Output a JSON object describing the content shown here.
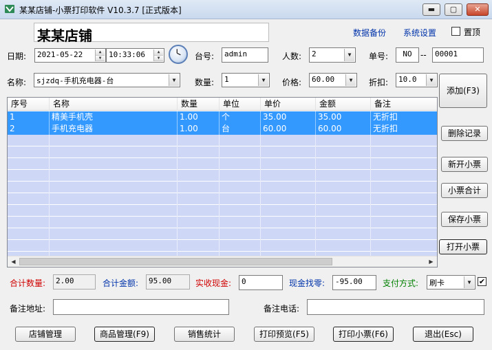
{
  "window": {
    "title": "某某店铺-小票打印软件 V10.3.7 [正式版本]",
    "minimize": "▬",
    "maximize": "▢",
    "close": "✕"
  },
  "header": {
    "shop_name": "某某店铺",
    "backup_link": "数据备份",
    "settings_link": "系统设置",
    "pin_label": "置顶",
    "pin_checked": false
  },
  "row1": {
    "date_label": "日期:",
    "date_value": "2021-05-22",
    "time_value": "10:33:06",
    "table_label": "台号:",
    "table_value": "admin",
    "people_label": "人数:",
    "people_value": "2",
    "order_label": "单号:",
    "order_prefix": "NO",
    "order_sep": "--",
    "order_number": "00001"
  },
  "row2": {
    "name_label": "名称:",
    "name_value": "sjzdq-手机充电器-台",
    "qty_label": "数量:",
    "qty_value": "1",
    "price_label": "价格:",
    "price_value": "60.00",
    "discount_label": "折扣:",
    "discount_value": "10.0"
  },
  "side_buttons": {
    "add": "添加(F3)",
    "delete": "删除记录",
    "new": "新开小票",
    "total": "小票合计",
    "save": "保存小票",
    "open": "打开小票"
  },
  "table": {
    "columns": [
      "序号",
      "名称",
      "数量",
      "单位",
      "单价",
      "金额",
      "备注"
    ],
    "rows": [
      [
        "1",
        "精美手机壳",
        "1.00",
        "个",
        "35.00",
        "35.00",
        "无折扣"
      ],
      [
        "2",
        "手机充电器",
        "1.00",
        "台",
        "60.00",
        "60.00",
        "无折扣"
      ]
    ]
  },
  "summary": {
    "total_qty_label": "合计数量:",
    "total_qty_value": "2.00",
    "total_amount_label": "合计金额:",
    "total_amount_value": "95.00",
    "cash_label": "实收现金:",
    "cash_value": "0",
    "change_label": "现金找零:",
    "change_value": "-95.00",
    "pay_label": "支付方式:",
    "pay_value": "刷卡",
    "pay_checked": true
  },
  "notes": {
    "address_label": "备注地址:",
    "address_value": "",
    "phone_label": "备注电话:",
    "phone_value": ""
  },
  "bottom_buttons": {
    "shop_mgmt": "店铺管理",
    "goods_mgmt": "商品管理(F9)",
    "sales_stats": "销售统计",
    "print_preview": "打印预览(F5)",
    "print_receipt": "打印小票(F6)",
    "exit": "退出(Esc)"
  },
  "colors": {
    "selected_row": "#3399ff",
    "empty_row": "#cfd7f7",
    "label_red": "#d00000",
    "label_blue": "#0033aa",
    "label_green": "#008000"
  }
}
